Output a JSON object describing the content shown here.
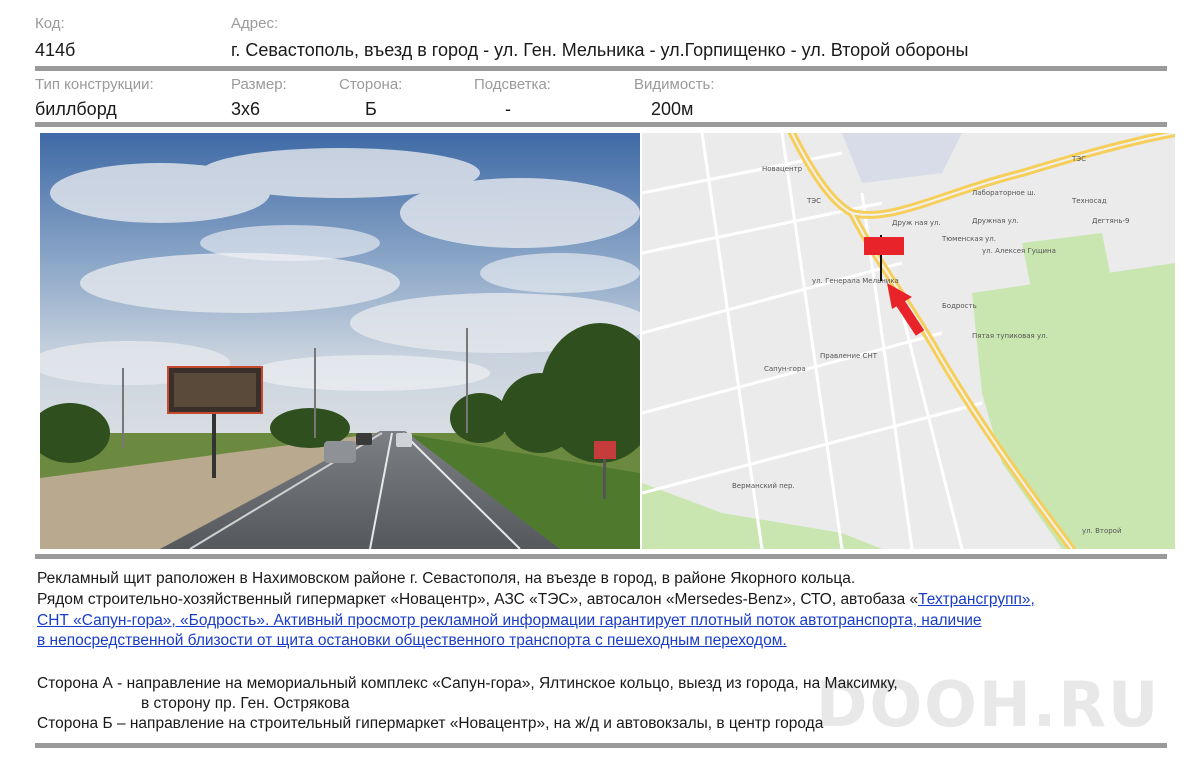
{
  "header": {
    "code_label": "Код:",
    "code_value": "414б",
    "address_label": "Адрес:",
    "address_value": "г. Севастополь, въезд в город - ул. Ген. Мельника - ул.Горпищенко - ул. Второй обороны"
  },
  "specs": {
    "type_label": "Тип конструкции:",
    "type_value": "биллборд",
    "size_label": "Размер:",
    "size_value": "3х6",
    "side_label": "Сторона:",
    "side_value": "Б",
    "light_label": "Подсветка:",
    "light_value": "-",
    "visibility_label": "Видимость:",
    "visibility_value": "200м"
  },
  "map": {
    "labels": [
      "Лабораторное ш.",
      "Новацентр",
      "ТЭС",
      "ТЭС",
      "Техносад",
      "Друж ная ул.",
      "Дружная ул.",
      "Тюменская ул.",
      "Правление СНТ",
      "Сапун-гора",
      "Бодрость",
      "ул. Алексея Гущина",
      "ул. Генерала Мельника",
      "ул. Второй",
      "Верманский пер.",
      "Дегтянь-9",
      "Пятая тупиковая ул."
    ]
  },
  "description": {
    "line1": "Рекламный щит раположен в Нахимовском районе г. Севастополя, на въезде в город, в районе Якорного кольца.",
    "line2_plain": "Рядом строительно-хозяйственный гипермаркет «Новацентр», АЗС «ТЭС», автосалон «Mersedes-Benz», СТО, автобаза «",
    "line2_link": "Техтрансгрупп»,",
    "line3_link": "СНТ «Сапун-гора», «Бодрость». Активный просмотр рекламной информации гарантирует плотный поток автотранспорта, наличие",
    "line4_link": "в непосредственной близости от щита остановки общественного транспорта с пешеходным переходом."
  },
  "sides": {
    "a_line1": "Сторона А  - направление на мемориальный комплекс «Сапун-гора», Ялтинское кольцо, выезд из города, на Максимку,",
    "a_line2": "в сторону пр. Ген. Острякова",
    "b_line1": "Сторона Б – направление на строительный гипермаркет «Новацентр», на ж/д и автовокзалы, в центр города"
  },
  "watermark": "DOOH.RU",
  "colors": {
    "rule": "#9a9a9a",
    "label": "#9a9a9a",
    "link": "#1a3cc8",
    "marker": "#e8232a"
  }
}
